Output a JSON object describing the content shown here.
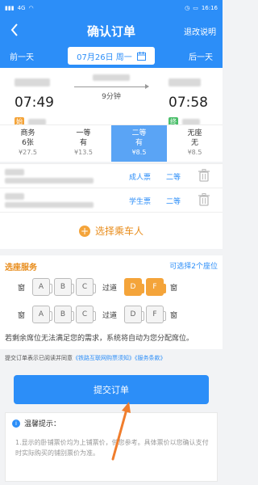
{
  "status_bar": {
    "signal_text": "4G",
    "time": "16:16"
  },
  "header": {
    "title": "确认订单",
    "refund_link": "退改说明"
  },
  "date_bar": {
    "prev": "前一天",
    "date": "07月26日 周一",
    "next": "后一天"
  },
  "train": {
    "depart_time": "07:49",
    "arrive_time": "07:58",
    "duration": "9分钟",
    "depart_badge": "始",
    "arrive_badge": "终"
  },
  "seat_tabs": [
    {
      "name": "商务",
      "avail": "6张",
      "price": "¥27.5"
    },
    {
      "name": "一等",
      "avail": "有",
      "price": "¥13.5"
    },
    {
      "name": "二等",
      "avail": "有",
      "price": "¥8.5"
    },
    {
      "name": "无座",
      "avail": "无",
      "price": "¥8.5"
    }
  ],
  "passengers": [
    {
      "ticket_type": "成人票",
      "seat_class": "二等"
    },
    {
      "ticket_type": "学生票",
      "seat_class": "二等"
    }
  ],
  "add_passenger": "选择乘车人",
  "seat_selection": {
    "title": "选座服务",
    "hint": "可选择2个座位",
    "window_label": "窗",
    "aisle_label": "过道",
    "rows": [
      [
        "A",
        "B",
        "C",
        "D",
        "F"
      ],
      [
        "A",
        "B",
        "C",
        "D",
        "F"
      ]
    ],
    "note": "若剩余席位无法满足您的需求，系统将自动为您分配席位。"
  },
  "agreement": {
    "prefix": "提交订单表示已阅读并同意",
    "link1": "《铁路互联网购票须知》",
    "link2": "《服务条款》"
  },
  "submit_label": "提交订单",
  "tips": {
    "title": "温馨提示：",
    "body": "1.显示的卧铺票价均为上铺票价，供您参考。具体票价以您确认支付时实际购买的铺别票价为准。"
  },
  "colors": {
    "primary": "#2c8ef8",
    "accent": "#f4a43a",
    "annotation_arrow": "#f07d2c"
  }
}
